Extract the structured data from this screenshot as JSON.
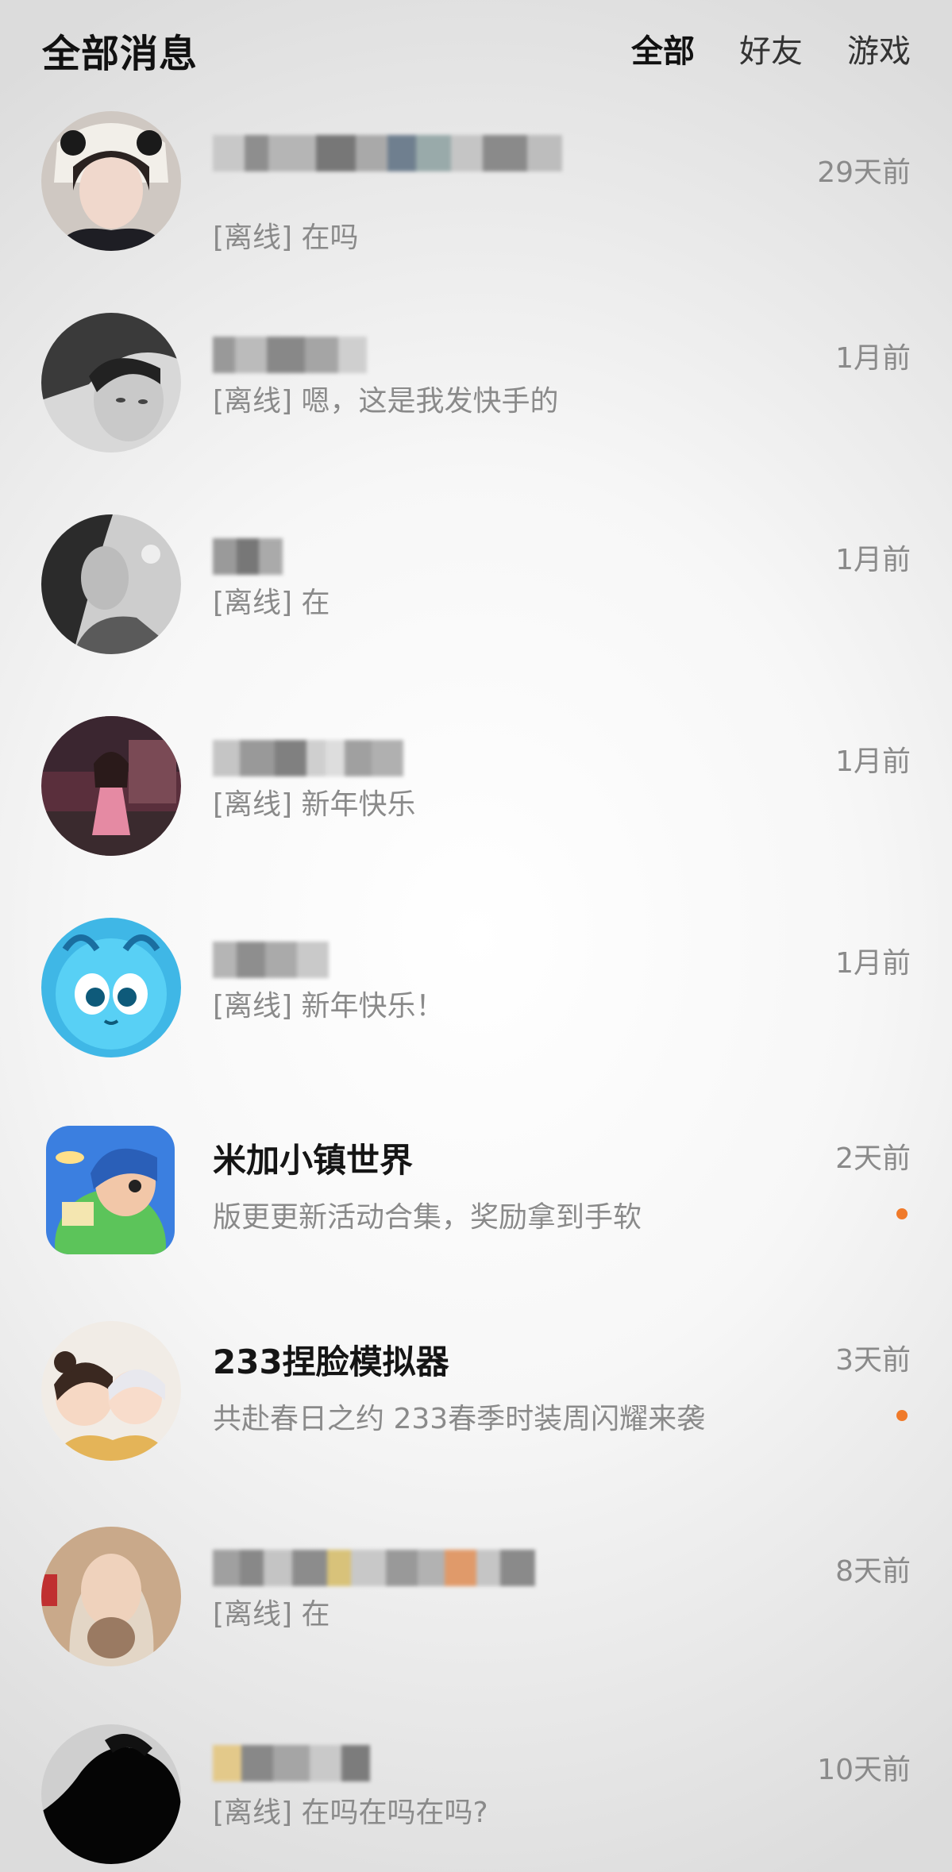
{
  "header": {
    "title": "全部消息",
    "tabs": [
      {
        "label": "全部",
        "active": true
      },
      {
        "label": "好友",
        "active": false
      },
      {
        "label": "游戏",
        "active": false
      }
    ]
  },
  "colors": {
    "unread_dot": "#f07a2a",
    "secondary_text": "#8a8a8a",
    "primary_text": "#111111"
  },
  "conversations": [
    {
      "name": "",
      "name_blurred": true,
      "preview": "[离线] 在吗",
      "time": "29天前",
      "unread": false
    },
    {
      "name": "",
      "name_blurred": true,
      "preview": "[离线] 嗯，这是我发快手的",
      "time": "1月前",
      "unread": false
    },
    {
      "name": "",
      "name_blurred": true,
      "preview": "[离线] 在",
      "time": "1月前",
      "unread": false
    },
    {
      "name": "",
      "name_blurred": true,
      "preview": "[离线] 新年快乐",
      "time": "1月前",
      "unread": false
    },
    {
      "name": "",
      "name_blurred": true,
      "preview": "[离线] 新年快乐！",
      "time": "1月前",
      "unread": false
    },
    {
      "name": "米加小镇世界",
      "name_blurred": false,
      "preview": "版更更新活动合集，奖励拿到手软",
      "time": "2天前",
      "unread": true
    },
    {
      "name": "233捏脸模拟器",
      "name_blurred": false,
      "preview": "共赴春日之约 233春季时装周闪耀来袭",
      "time": "3天前",
      "unread": true
    },
    {
      "name": "",
      "name_blurred": true,
      "preview": "[离线] 在",
      "time": "8天前",
      "unread": false
    },
    {
      "name": "",
      "name_blurred": true,
      "preview": "[离线] 在吗在吗在吗?",
      "time": "10天前",
      "unread": false
    }
  ]
}
